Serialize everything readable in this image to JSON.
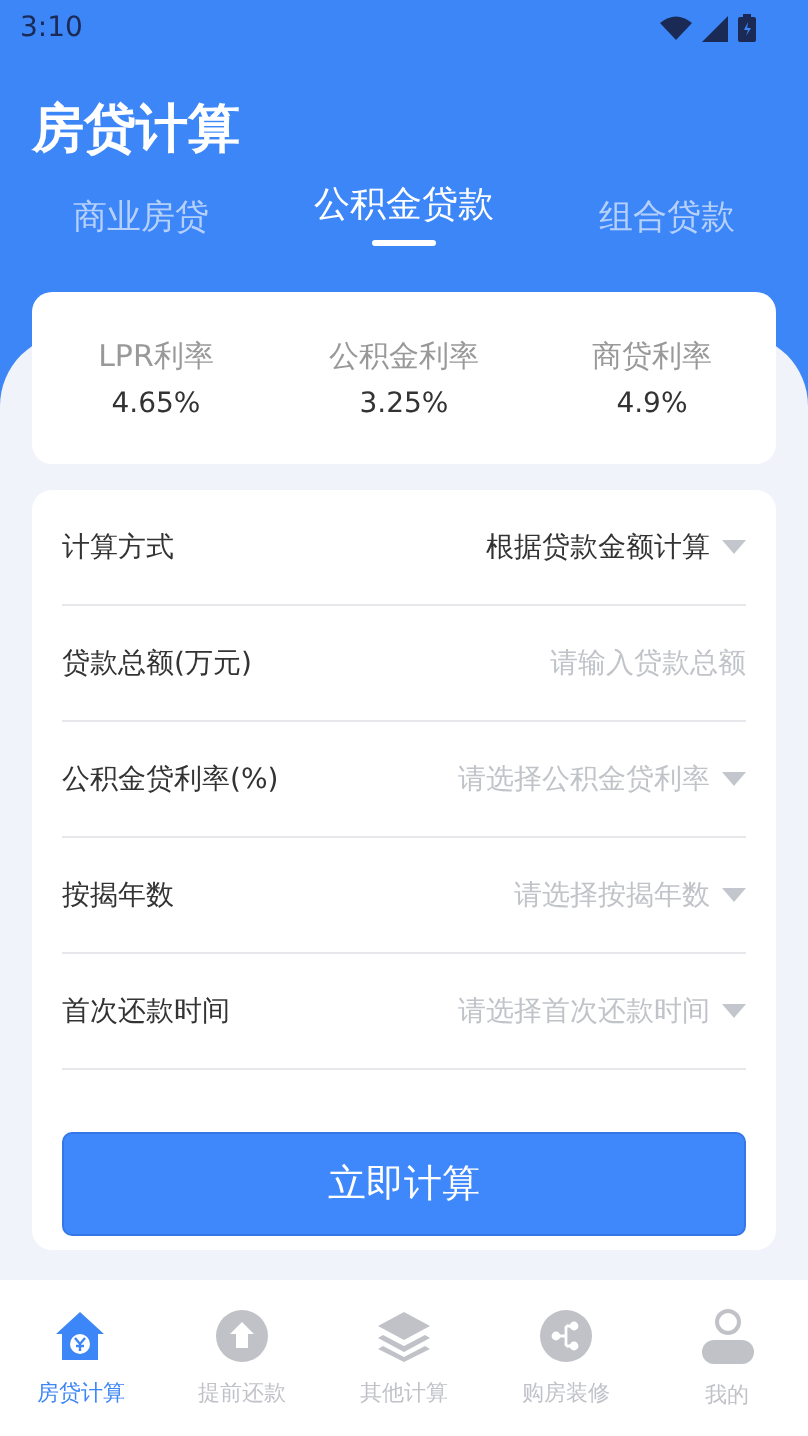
{
  "status_bar": {
    "time": "3:10"
  },
  "title": "房贷计算",
  "tabs": [
    {
      "label": "商业房贷",
      "selected": false
    },
    {
      "label": "公积金贷款",
      "selected": true
    },
    {
      "label": "组合贷款",
      "selected": false
    }
  ],
  "rates": [
    {
      "label": "LPR利率",
      "value": "4.65%"
    },
    {
      "label": "公积金利率",
      "value": "3.25%"
    },
    {
      "label": "商贷利率",
      "value": "4.9%"
    }
  ],
  "form": [
    {
      "kind": "select",
      "label": "计算方式",
      "value": "根据贷款金额计算"
    },
    {
      "kind": "input",
      "label": "贷款总额(万元)",
      "placeholder": "请输入贷款总额"
    },
    {
      "kind": "select",
      "label": "公积金贷利率(%)",
      "placeholder": "请选择公积金贷利率"
    },
    {
      "kind": "select",
      "label": "按揭年数",
      "placeholder": "请选择按揭年数"
    },
    {
      "kind": "select",
      "label": "首次还款时间",
      "placeholder": "请选择首次还款时间"
    }
  ],
  "submit_button": "立即计算",
  "nav": [
    {
      "kind": "house",
      "label": "房贷计算",
      "selected": true
    },
    {
      "kind": "upload",
      "label": "提前还款",
      "selected": false
    },
    {
      "kind": "layers",
      "label": "其他计算",
      "selected": false
    },
    {
      "kind": "share",
      "label": "购房装修",
      "selected": false
    },
    {
      "kind": "person",
      "label": "我的",
      "selected": false
    }
  ]
}
